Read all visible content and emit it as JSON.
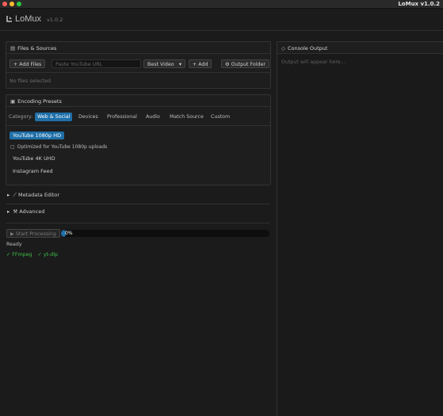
{
  "window": {
    "title": "LoMux v1.0.2"
  },
  "header": {
    "brand": "LoMux",
    "version": "v1.0.2"
  },
  "files": {
    "title": "Files & Sources",
    "add_files": "+ Add Files",
    "url_placeholder": "Paste YouTube URL",
    "quality_selected": "Best Video",
    "add": "+ Add",
    "output_folder": "Output Folder",
    "empty": "No files selected"
  },
  "presets": {
    "title": "Encoding Presets",
    "category_label": "Category:",
    "tabs": [
      "Web & Social",
      "Devices",
      "Professional",
      "Audio",
      "Match Source",
      "Custom"
    ],
    "items": [
      "YouTube 1080p HD",
      "YouTube 4K UHD",
      "Instagram Feed"
    ],
    "selected_desc": "Optimized for YouTube 1080p uploads"
  },
  "metadata": {
    "label": "Metadata Editor"
  },
  "advanced": {
    "label": "Advanced"
  },
  "process": {
    "start_label": "Start Processing",
    "progress_text": "0%",
    "progress_fraction": 0.02,
    "status": "Ready",
    "deps": [
      "✓ FFmpeg",
      "✓ yt-dlp"
    ]
  },
  "console": {
    "title": "Console Output",
    "placeholder": "Output will appear here..."
  },
  "colors": {
    "accent": "#1f6fa8",
    "success": "#3fbf4a",
    "background": "#1b1b1b"
  }
}
